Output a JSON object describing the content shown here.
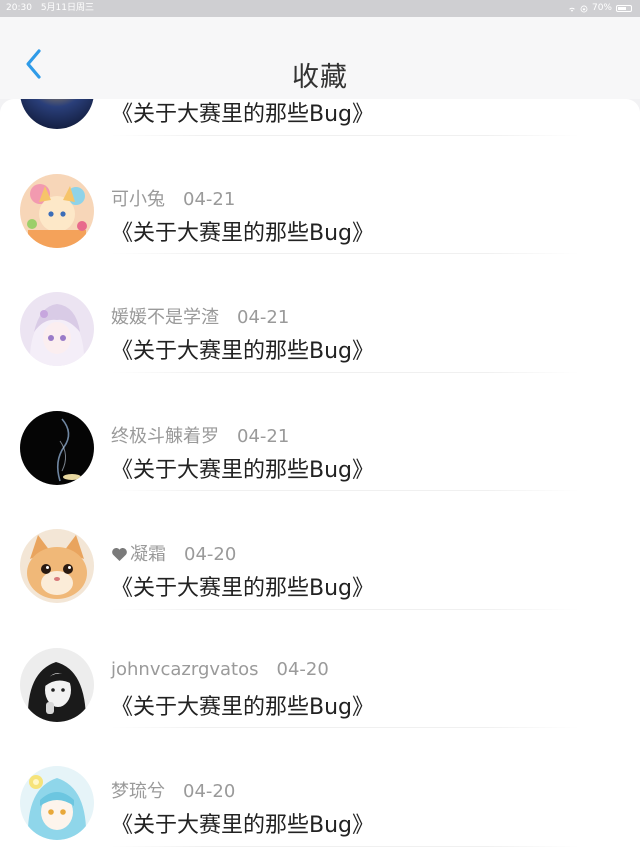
{
  "status_bar": {
    "time": "20:30",
    "date": "5月11日周三",
    "battery": "70%",
    "battery_level": 0.7
  },
  "header": {
    "title": "收藏",
    "back_icon": "chevron-left-icon",
    "accent_color": "#2f9be8"
  },
  "favorites": [
    {
      "user": "",
      "date": "",
      "title": "《关于大赛里的那些Bug》"
    },
    {
      "user": "可小兔",
      "date": "04-21",
      "title": "《关于大赛里的那些Bug》"
    },
    {
      "user": "媛媛不是学渣",
      "date": "04-21",
      "title": "《关于大赛里的那些Bug》"
    },
    {
      "user": "终极斗觫着罗",
      "date": "04-21",
      "title": "《关于大赛里的那些Bug》"
    },
    {
      "user": "凝霜",
      "date": "04-20",
      "title": "《关于大赛里的那些Bug》",
      "badge_icon": "heart-icon"
    },
    {
      "user": "johnvcazrgvatos",
      "date": "04-20",
      "title": "《关于大赛里的那些Bug》"
    },
    {
      "user": "梦琉兮",
      "date": "04-20",
      "title": "《关于大赛里的那些Bug》"
    }
  ]
}
